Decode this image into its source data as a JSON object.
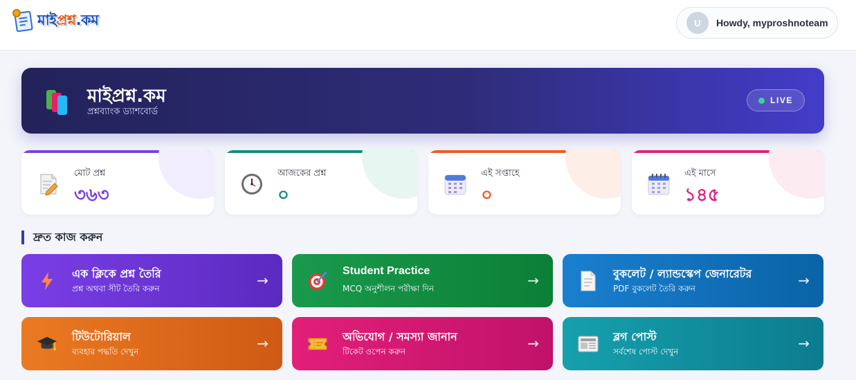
{
  "header": {
    "logo_text_part1": "মাই",
    "logo_text_part2": "প্রশ্ন",
    "logo_text_part3": ".কম",
    "user": {
      "avatar_initial": "U",
      "greeting": "Howdy, myproshnoteam"
    }
  },
  "hero": {
    "icon": "books-icon",
    "title": "মাইপ্রশ্ন.কম",
    "subtitle": "প্রশ্নব্যাংক ড্যাশবোর্ড",
    "live_label": "LIVE",
    "live_color": "#34d399"
  },
  "stats": [
    {
      "icon": "memo-icon",
      "label": "মোট প্রশ্ন",
      "value": "৩৬৩",
      "accent": "#7b3fe4"
    },
    {
      "icon": "clock-icon",
      "label": "আজকের প্রশ্ন",
      "value": "০",
      "accent": "#0f8f7a"
    },
    {
      "icon": "calendar-icon",
      "label": "এই সপ্তাহে",
      "value": "০",
      "accent": "#ef5a24"
    },
    {
      "icon": "spiral-calendar-icon",
      "label": "এই মাসে",
      "value": "১৪৫",
      "accent": "#e0237a"
    }
  ],
  "quick_actions": {
    "heading": "দ্রুত কাজ করুন",
    "items": [
      {
        "icon": "lightning-icon",
        "title": "এক ক্লিকে প্রশ্ন তৈরি",
        "subtitle": "প্রশ্ন অথবা সীট তৈরি করুন",
        "arrow": "→"
      },
      {
        "icon": "target-icon",
        "title": "Student Practice",
        "subtitle": "MCQ অনুশীলন পরীক্ষা দিন",
        "arrow": "→"
      },
      {
        "icon": "document-icon",
        "title": "বুকলেট / ল্যান্ডস্কেপ জেনারেটর",
        "subtitle": "PDF বুকলেট তৈরি করুন",
        "arrow": "→"
      },
      {
        "icon": "graduation-cap-icon",
        "title": "টিউটোরিয়াল",
        "subtitle": "ব্যবহার পদ্ধতি দেখুন",
        "arrow": "→"
      },
      {
        "icon": "ticket-icon",
        "title": "অভিযোগ / সমস্যা জানান",
        "subtitle": "টিকেট ওপেন করুন",
        "arrow": "→"
      },
      {
        "icon": "newspaper-icon",
        "title": "ব্লগ পোস্ট",
        "subtitle": "সর্বশেষ পোস্ট দেখুন",
        "arrow": "→"
      }
    ]
  }
}
